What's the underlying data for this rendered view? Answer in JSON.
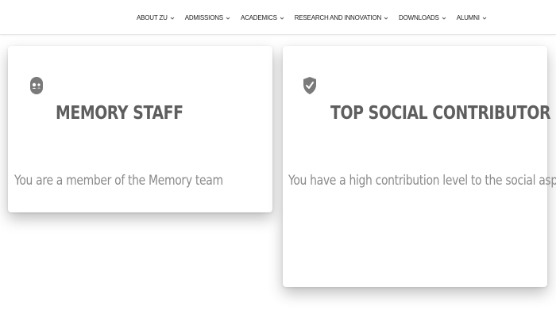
{
  "nav": {
    "items": [
      {
        "label": "ABOUT ZU"
      },
      {
        "label": "ADMISSIONS"
      },
      {
        "label": "ACADEMICS"
      },
      {
        "label": "RESEARCH AND INNOVATION"
      },
      {
        "label": "DOWNLOADS"
      },
      {
        "label": "ALUMNI"
      }
    ],
    "chevron_icon": "chevron-down-icon"
  },
  "badges": [
    {
      "icon": "memory-staff-icon",
      "title": "MEMORY STAFF",
      "description": "You are a member of the Memory team"
    },
    {
      "icon": "shield-check-icon",
      "title": "TOP SOCIAL CONTRIBUTOR",
      "description": "You have a high contribution level to the social aspects"
    }
  ],
  "colors": {
    "title": "#5e5e5e",
    "description": "#8a8a8a",
    "icon": "#7a7a7a",
    "nav_text": "#222222"
  }
}
